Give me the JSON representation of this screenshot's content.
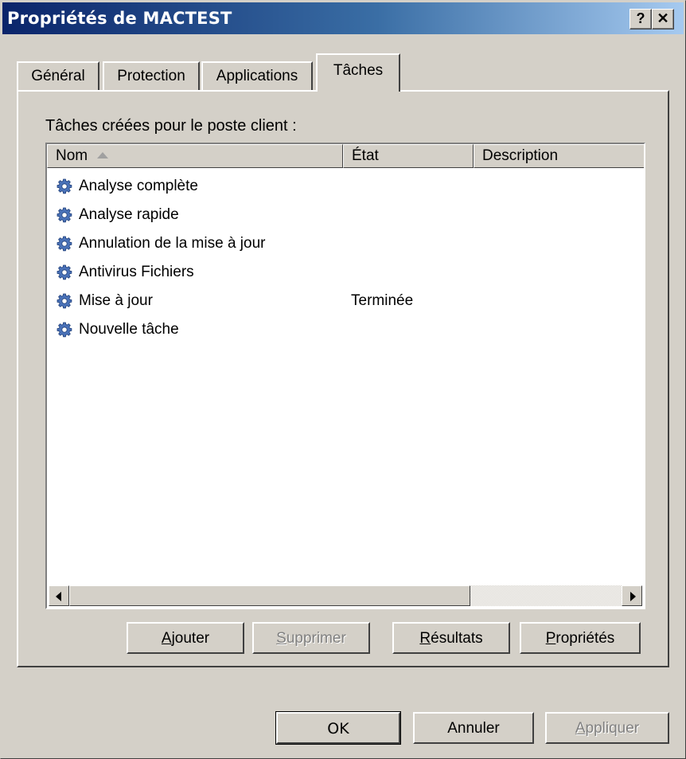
{
  "window": {
    "title": "Propriétés de MACTEST",
    "help_label": "?",
    "close_label": "✕"
  },
  "tabs": [
    {
      "label": "Général"
    },
    {
      "label": "Protection"
    },
    {
      "label": "Applications"
    },
    {
      "label": "Tâches",
      "active": true
    }
  ],
  "panel": {
    "section_label": "Tâches créées pour le poste client :"
  },
  "list": {
    "columns": [
      "Nom",
      "État",
      "Description"
    ],
    "sorted_column": "Nom",
    "sort_direction": "ascending",
    "rows": [
      {
        "name": "Analyse complète",
        "state": "",
        "icon": "gear-icon"
      },
      {
        "name": "Analyse rapide",
        "state": "",
        "icon": "gear-icon"
      },
      {
        "name": "Annulation de la mise à jour",
        "state": "",
        "icon": "gear-icon"
      },
      {
        "name": "Antivirus Fichiers",
        "state": "",
        "icon": "gear-icon"
      },
      {
        "name": "Mise à jour",
        "state": "Terminée",
        "icon": "gear-icon"
      },
      {
        "name": "Nouvelle tâche",
        "state": "",
        "icon": "gear-icon"
      }
    ]
  },
  "list_buttons": {
    "add": {
      "label": "Ajouter",
      "mnemonic": "A",
      "rest": "jouter",
      "enabled": true
    },
    "delete": {
      "label": "Supprimer",
      "mnemonic": "S",
      "rest": "upprimer",
      "enabled": false
    },
    "results": {
      "label": "Résultats",
      "mnemonic": "R",
      "rest": "ésultats",
      "enabled": true
    },
    "properties": {
      "label": "Propriétés",
      "mnemonic": "P",
      "rest": "ropriétés",
      "enabled": true
    }
  },
  "dialog_buttons": {
    "ok": {
      "label": "OK",
      "enabled": true
    },
    "cancel": {
      "label": "Annuler",
      "enabled": true
    },
    "apply": {
      "label": "Appliquer",
      "mnemonic": "A",
      "rest": "ppliquer",
      "enabled": false
    }
  },
  "colors": {
    "face": "#d4d0c8",
    "title_start": "#0a246a",
    "title_end": "#a6caf0",
    "gear": "#4a72b8"
  }
}
